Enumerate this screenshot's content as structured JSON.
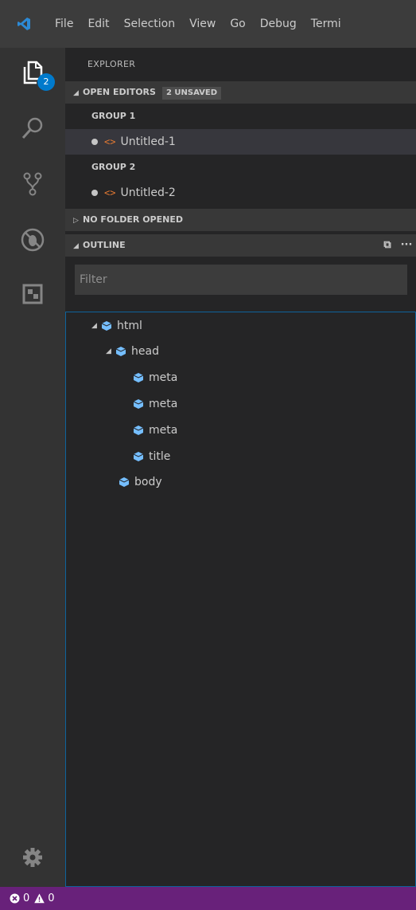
{
  "menu": [
    "File",
    "Edit",
    "Selection",
    "View",
    "Go",
    "Debug",
    "Termi"
  ],
  "activity": {
    "explorer_badge": "2"
  },
  "sidebar": {
    "title": "EXPLORER",
    "open_editors": {
      "header": "OPEN EDITORS",
      "tag": "2 UNSAVED",
      "groups": [
        {
          "label": "GROUP 1",
          "file": "Untitled-1"
        },
        {
          "label": "GROUP 2",
          "file": "Untitled-2"
        }
      ]
    },
    "no_folder": {
      "header": "NO FOLDER OPENED"
    },
    "outline": {
      "header": "OUTLINE",
      "filter_placeholder": "Filter",
      "nodes": [
        "html",
        "head",
        "meta",
        "meta",
        "meta",
        "title",
        "body"
      ]
    }
  },
  "status": {
    "errors": "0",
    "warnings": "0"
  },
  "colors": {
    "accent": "#007acc",
    "statusbar": "#68217a",
    "symbol_icon": "#75beff",
    "file_icon": "#e37933"
  }
}
